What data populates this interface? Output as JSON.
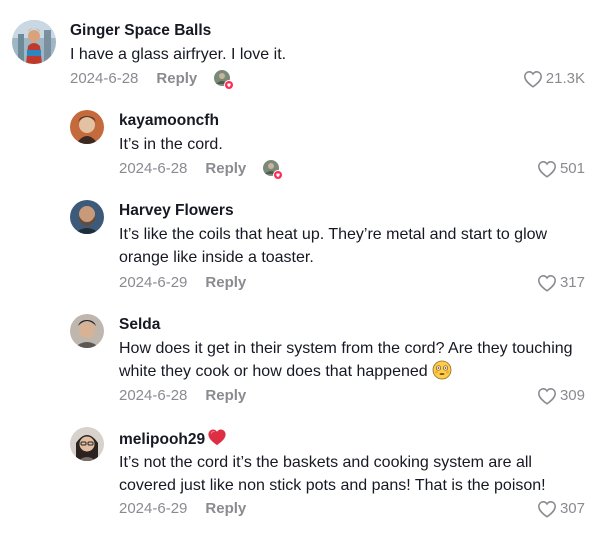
{
  "comments": [
    {
      "username": "Ginger Space Balls",
      "text": "I have a glass airfryer. I love it.",
      "date": "2024-6-28",
      "reply_label": "Reply",
      "likes": "21.3K",
      "liked_by_creator": true
    },
    {
      "username": "kayamooncfh",
      "text": "It’s in the cord.",
      "date": "2024-6-28",
      "reply_label": "Reply",
      "likes": "501",
      "liked_by_creator": true
    },
    {
      "username": "Harvey Flowers",
      "text_line1": "It’s like the coils that heat up. They’re metal and start to glow",
      "text_line2": "orange like inside a toaster.",
      "date": "2024-6-29",
      "reply_label": "Reply",
      "likes": "317"
    },
    {
      "username": "Selda",
      "text_line1": "How does it get in their system from the cord? Are they touching",
      "text_line2": "white they cook or how does that happened",
      "date": "2024-6-28",
      "reply_label": "Reply",
      "likes": "309"
    },
    {
      "username": "melipooh29",
      "text_line1": "It’s not the cord it’s the baskets and cooking system are all",
      "text_line2": "covered just like non stick pots and pans! That is the poison!",
      "date": "2024-6-29",
      "reply_label": "Reply",
      "likes": "307"
    }
  ],
  "colors": {
    "text": "#161823",
    "muted": "#8a8b91",
    "heart_badge": "#fe2c55"
  },
  "icons": {
    "like": "heart-outline-icon",
    "creator_like": "creator-liked-avatar-icon",
    "username_emoji": "red-heart-emoji",
    "text_emoji": "flushed-face-emoji"
  }
}
